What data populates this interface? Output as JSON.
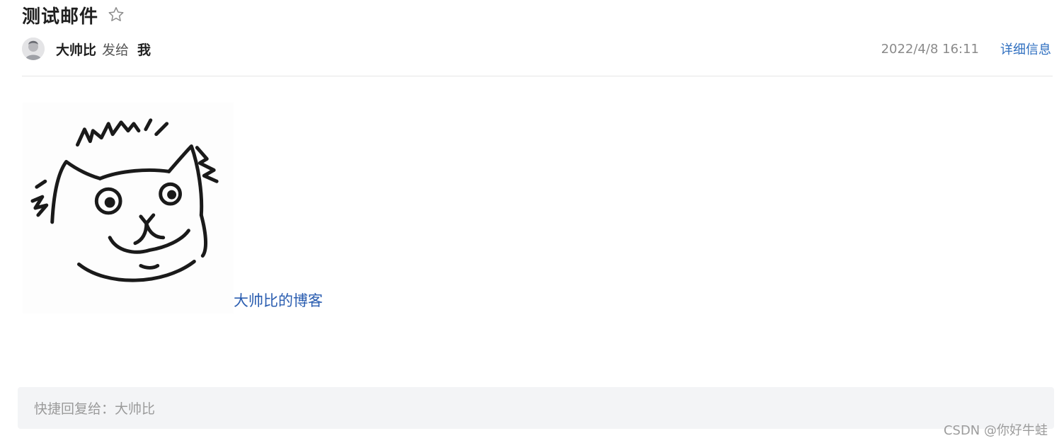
{
  "email": {
    "subject": "测试邮件",
    "sender": "大帅比",
    "sent_to_text": "发给",
    "recipient": "我",
    "timestamp": "2022/4/8 16:11",
    "details_link": "详细信息"
  },
  "body": {
    "link_text": "大帅比的博客"
  },
  "quick_reply": {
    "label": "快捷回复给：大帅比"
  },
  "watermark": "CSDN @你好牛蛙",
  "colors": {
    "link": "#2a5db0",
    "details_link": "#2f6fc0",
    "quick_reply_bg": "#f3f4f6"
  },
  "icons": {
    "star": "star-outline-icon",
    "avatar": "avatar-image"
  }
}
